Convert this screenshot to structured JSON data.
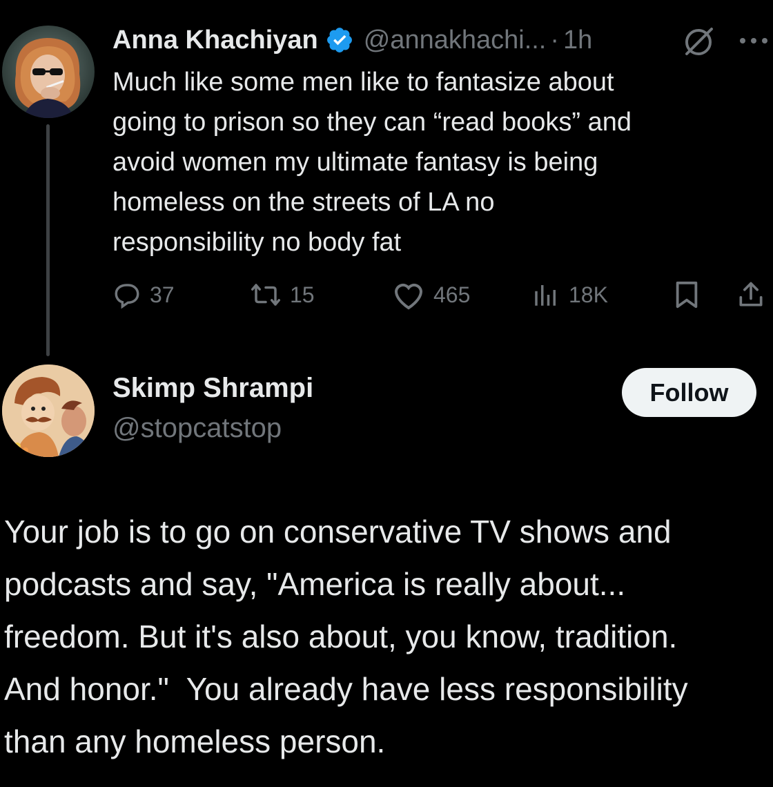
{
  "parent_tweet": {
    "author_name": "Anna Khachiyan",
    "verified": true,
    "handle": "@annakhachi...",
    "separator": "·",
    "time": "1h",
    "text_lines": [
      "Much like some men like to fantasize about",
      "going to prison so they can “read books” and",
      "avoid women my ultimate fantasy is being",
      "homeless on the streets of LA no",
      "responsibility no body fat"
    ],
    "actions": {
      "replies": "37",
      "reposts": "15",
      "likes": "465",
      "views": "18K"
    },
    "icons": {
      "more": "more-horizontal-icon",
      "grok": "grok-icon",
      "reply": "reply-icon",
      "repost": "repost-icon",
      "like": "heart-icon",
      "views": "views-chart-icon",
      "bookmark": "bookmark-icon",
      "share": "share-icon"
    }
  },
  "reply": {
    "author_name": "Skimp Shrampi",
    "handle": "@stopcatstop",
    "follow_label": "Follow",
    "text_lines": [
      "Your job is to go on conservative TV shows and",
      "podcasts and say, \"America is really about...",
      "freedom. But it's also about, you know, tradition.",
      "And honor.\"  You already have less responsibility",
      "than any homeless person."
    ]
  },
  "colors": {
    "background": "#000000",
    "text_primary": "#e7e9ea",
    "text_secondary": "#71767b",
    "verified_blue": "#1d9bf0",
    "follow_button_bg": "#eff3f4",
    "thread_line": "#3e4144"
  }
}
